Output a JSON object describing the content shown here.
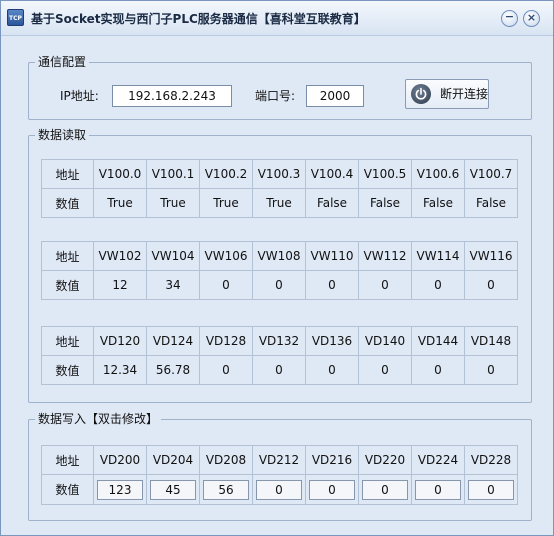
{
  "window": {
    "icon_text": "TCP",
    "title": "基于Socket实现与西门子PLC服务器通信【喜科堂互联教育】",
    "minimize_glyph": "−",
    "close_glyph": "×"
  },
  "config": {
    "legend": "通信配置",
    "ip_label": "IP地址:",
    "ip_value": "192.168.2.243",
    "port_label": "端口号:",
    "port_value": "2000",
    "disconnect_label": "断开连接"
  },
  "read": {
    "legend": "数据读取",
    "tables": [
      {
        "addr_label": "地址",
        "value_label": "数值",
        "addresses": [
          "V100.0",
          "V100.1",
          "V100.2",
          "V100.3",
          "V100.4",
          "V100.5",
          "V100.6",
          "V100.7"
        ],
        "values": [
          "True",
          "True",
          "True",
          "True",
          "False",
          "False",
          "False",
          "False"
        ]
      },
      {
        "addr_label": "地址",
        "value_label": "数值",
        "addresses": [
          "VW102",
          "VW104",
          "VW106",
          "VW108",
          "VW110",
          "VW112",
          "VW114",
          "VW116"
        ],
        "values": [
          "12",
          "34",
          "0",
          "0",
          "0",
          "0",
          "0",
          "0"
        ]
      },
      {
        "addr_label": "地址",
        "value_label": "数值",
        "addresses": [
          "VD120",
          "VD124",
          "VD128",
          "VD132",
          "VD136",
          "VD140",
          "VD144",
          "VD148"
        ],
        "values": [
          "12.34",
          "56.78",
          "0",
          "0",
          "0",
          "0",
          "0",
          "0"
        ]
      }
    ]
  },
  "write": {
    "legend": "数据写入【双击修改】",
    "addr_label": "地址",
    "value_label": "数值",
    "addresses": [
      "VD200",
      "VD204",
      "VD208",
      "VD212",
      "VD216",
      "VD220",
      "VD224",
      "VD228"
    ],
    "values": [
      "123",
      "45",
      "56",
      "0",
      "0",
      "0",
      "0",
      "0"
    ]
  }
}
